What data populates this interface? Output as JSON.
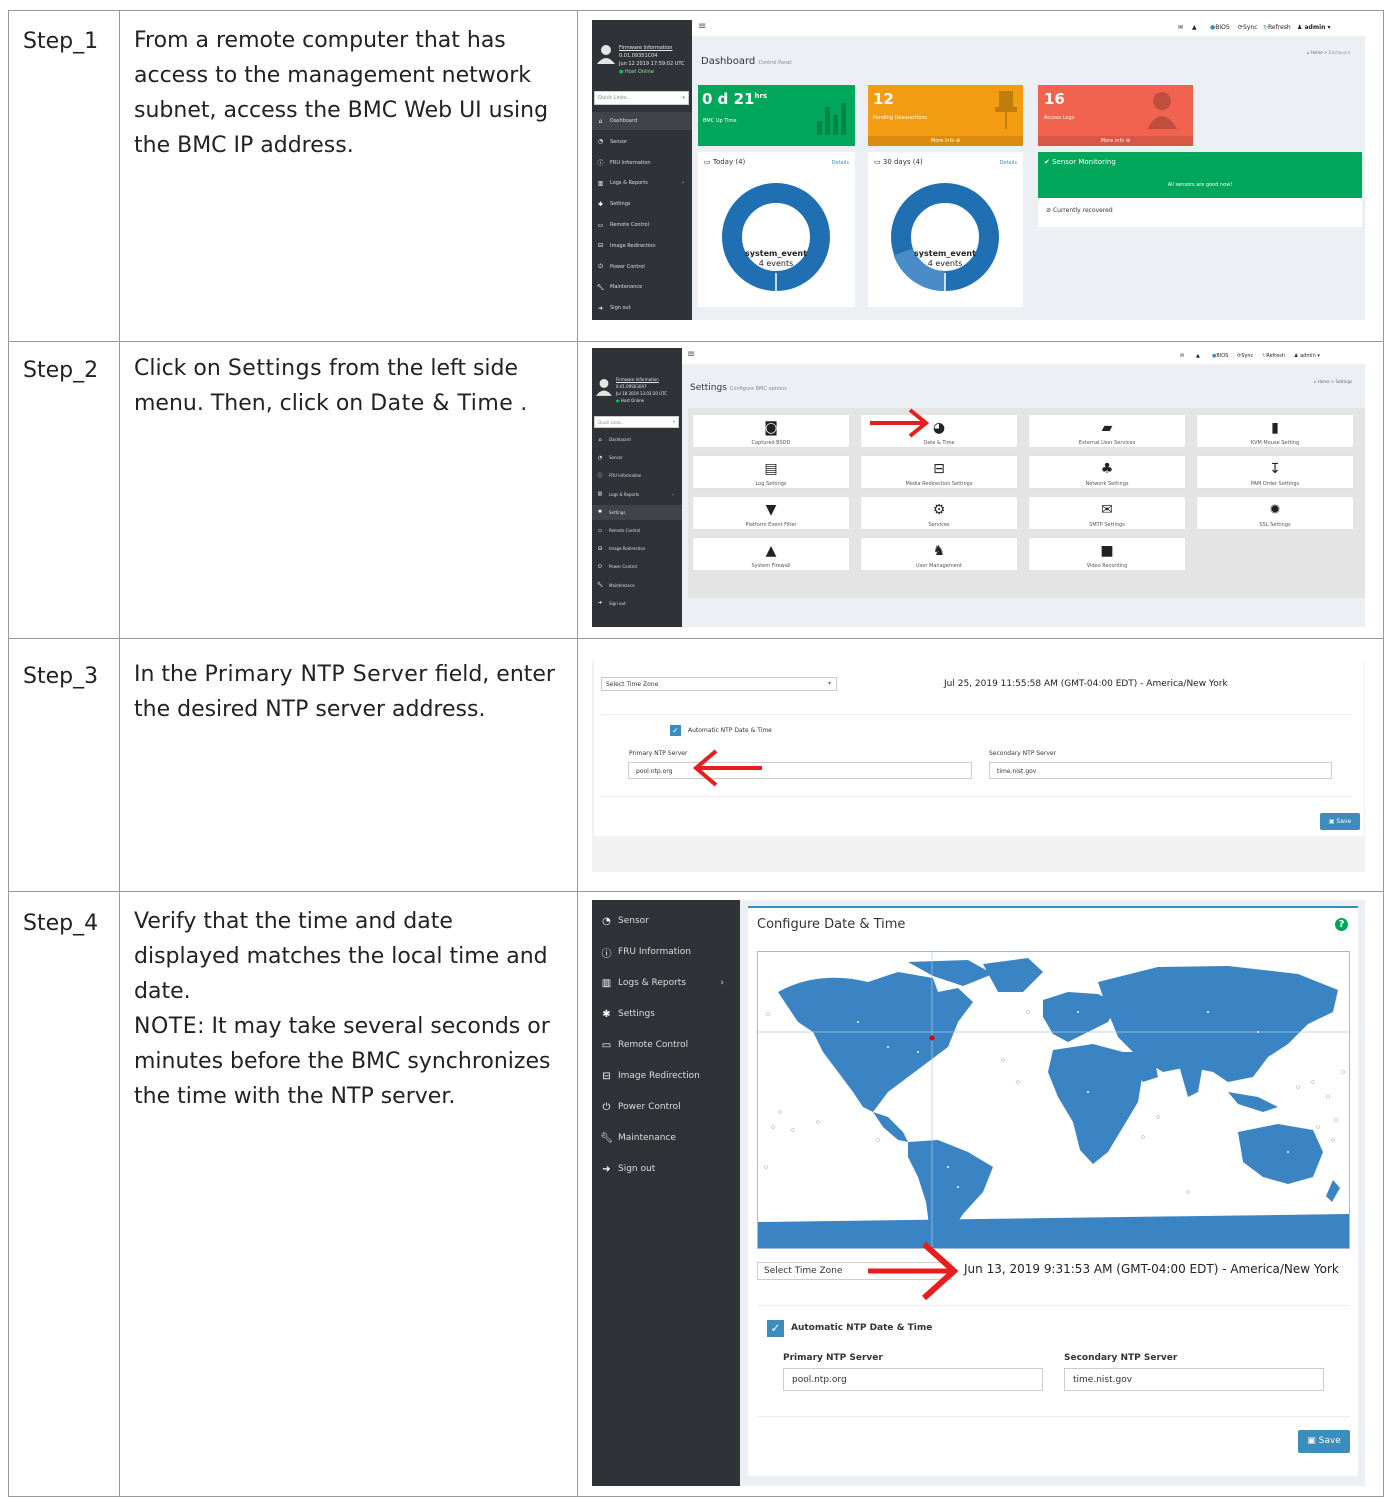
{
  "steps": [
    {
      "label": "Step_1",
      "text_parts": [
        "From a remote computer that has access to the management network subnet, access the BMC Web UI using the BMC IP address."
      ]
    },
    {
      "label": "Step_2",
      "text_pre": "Click on ",
      "bold1": "Settings",
      "text_mid": " from the left side menu. Then, click on ",
      "bold2": "Date & Time",
      "text_post": " ."
    },
    {
      "label": "Step_3",
      "text_pre": "In the ",
      "bold1": "Primary NTP Server",
      "text_post": " field, enter the desired NTP server address."
    },
    {
      "label": "Step_4",
      "text_pre": "Verify that the time and date displayed matches the local time and date.",
      "note_label": "NOTE",
      "note_text": ": It may take several seconds or minutes before the BMC synchronizes the time with the NTP server."
    }
  ],
  "shot1": {
    "firmware_label": "Firmware Information",
    "firmware_version": "0.01.09351C04",
    "firmware_date": "Jun 12 2019 17:59:02 UTC",
    "host_status": "Host Online",
    "quick_links": "Quick Links...",
    "menu": [
      "Dashboard",
      "Sensor",
      "FRU Information",
      "Logs & Reports",
      "Settings",
      "Remote Control",
      "Image Redirection",
      "Power Control",
      "Maintenance",
      "Sign out"
    ],
    "menu_icons": [
      "home-icon",
      "gauge-icon",
      "info-icon",
      "chart-icon",
      "gear-icon",
      "monitor-icon",
      "drive-icon",
      "power-icon",
      "wrench-icon",
      "signout-icon"
    ],
    "top": {
      "bios": "BIOS",
      "sync": "Sync",
      "refresh": "Refresh",
      "user": "admin"
    },
    "title": "Dashboard",
    "subtitle": "Control Panel",
    "breadcrumb_home": "Home",
    "breadcrumb_current": "Dashboard",
    "box1": {
      "value": "0 d 21",
      "unit": "hrs",
      "label": "BMC Up Time",
      "color": "#00a65a"
    },
    "box2": {
      "value": "12",
      "label": "Pending Deassertions",
      "more": "More info",
      "color": "#f39c12"
    },
    "box3": {
      "value": "16",
      "label": "Access Logs",
      "more": "More info",
      "color": "#dd4b39"
    },
    "today": {
      "title": "Today",
      "count": "(4)",
      "details": "Details",
      "event": "system_event",
      "events": "4 events"
    },
    "days30": {
      "title": "30 days",
      "count": "(4)",
      "details": "Details",
      "event": "system_event",
      "events": "4 events"
    },
    "sensor": {
      "title": "Sensor Monitoring",
      "ok": "All sensors are good now!",
      "recovered": "Currently recovered"
    }
  },
  "shot2": {
    "firmware_label": "Firmware Information",
    "firmware_version": "0.01.09S630A7",
    "firmware_date": "Jul 18 2019 13:03:20 UTC",
    "host_status": "Host Online",
    "quick_links": "Quick Links...",
    "menu": [
      "Dashboard",
      "Sensor",
      "FRU Information",
      "Logs & Reports",
      "Settings",
      "Remote Control",
      "Image Redirection",
      "Power Control",
      "Maintenance",
      "Sign out"
    ],
    "top": {
      "bios": "BIOS",
      "sync": "Sync",
      "refresh": "Refresh",
      "user": "admin"
    },
    "title": "Settings",
    "subtitle": "Configure BMC options",
    "breadcrumb_home": "Home",
    "breadcrumb_current": "Settings",
    "tiles": [
      "Captured BSOD",
      "Date & Time",
      "External User Services",
      "KVM Mouse Setting",
      "Log Settings",
      "Media Redirection Settings",
      "Network Settings",
      "PAM Order Settings",
      "Platform Event Filter",
      "Services",
      "SMTP Settings",
      "SSL Settings",
      "System Firewall",
      "User Management",
      "Video Recording"
    ],
    "tile_icons": [
      "camera-icon",
      "clock-icon",
      "book-icon",
      "mouse-icon",
      "file-icon",
      "drive-icon",
      "sitemap-icon",
      "sort-icon",
      "filter-icon",
      "gears-icon",
      "envelope-icon",
      "certificate-icon",
      "lock-icon",
      "users-icon",
      "video-icon"
    ]
  },
  "shot3": {
    "timezone_placeholder": "Select Time Zone",
    "datetime": "Jul 25, 2019 11:55:58 AM (GMT-04:00 EDT)  -  America/New York",
    "auto_ntp": "Automatic NTP Date & Time",
    "primary_label": "Primary NTP Server",
    "primary_value": "pool.ntp.org",
    "secondary_label": "Secondary NTP Server",
    "secondary_value": "time.nist.gov",
    "save": "Save"
  },
  "shot4": {
    "menu": [
      "Sensor",
      "FRU Information",
      "Logs & Reports",
      "Settings",
      "Remote Control",
      "Image Redirection",
      "Power Control",
      "Maintenance",
      "Sign out"
    ],
    "title": "Configure Date & Time",
    "timezone_placeholder": "Select Time Zone",
    "datetime": "Jun 13, 2019 9:31:53 AM (GMT-04:00 EDT)  -  America/New York",
    "auto_ntp": "Automatic NTP Date & Time",
    "primary_label": "Primary NTP Server",
    "primary_value": "pool.ntp.org",
    "secondary_label": "Secondary NTP Server",
    "secondary_value": "time.nist.gov",
    "save": "Save"
  },
  "colors": {
    "accent": "#3c8dbc",
    "arrow": "#e81e1e",
    "sidebar": "#2f3337",
    "map_ocean": "#ffffff",
    "map_land": "#3a84c4"
  }
}
